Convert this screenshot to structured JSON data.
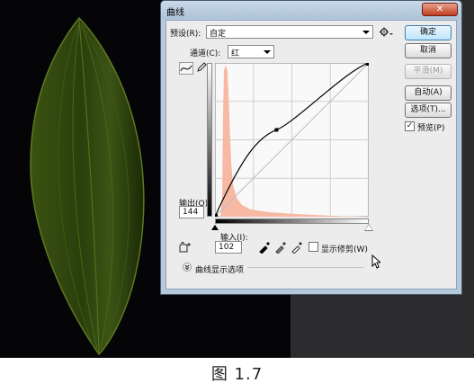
{
  "dialog": {
    "title": "曲线",
    "close_label": "✕",
    "preset_label": "预设(R):",
    "preset_value": "自定",
    "channel_label": "通道(C):",
    "channel_value": "红",
    "output_label": "输出(O):",
    "output_value": "144",
    "input_label": "输入(I):",
    "input_value": "102",
    "show_clipping_label": "显示修剪(W)",
    "show_clipping_checked": false,
    "curve_display_options_label": "曲线显示选项",
    "preview_label": "预览(P)",
    "preview_checked": true,
    "buttons": {
      "ok": "确定",
      "cancel": "取消",
      "smooth": "平滑(M)",
      "auto": "自动(A)",
      "options": "选项(T)..."
    }
  },
  "icons": {
    "settings": "gear-icon",
    "curve_tool": "curve-point-icon",
    "pencil_tool": "pencil-icon",
    "black_eyedropper": "eyedropper-black-icon",
    "gray_eyedropper": "eyedropper-gray-icon",
    "white_eyedropper": "eyedropper-white-icon",
    "targeted_adjust": "hand-adjust-icon",
    "expand": "chevron-down-icon"
  },
  "curve": {
    "channel_color": "#000000",
    "histogram_color": "#f7b8a4",
    "control_point": {
      "input": 102,
      "output": 144
    }
  },
  "caption": "图  1.7"
}
